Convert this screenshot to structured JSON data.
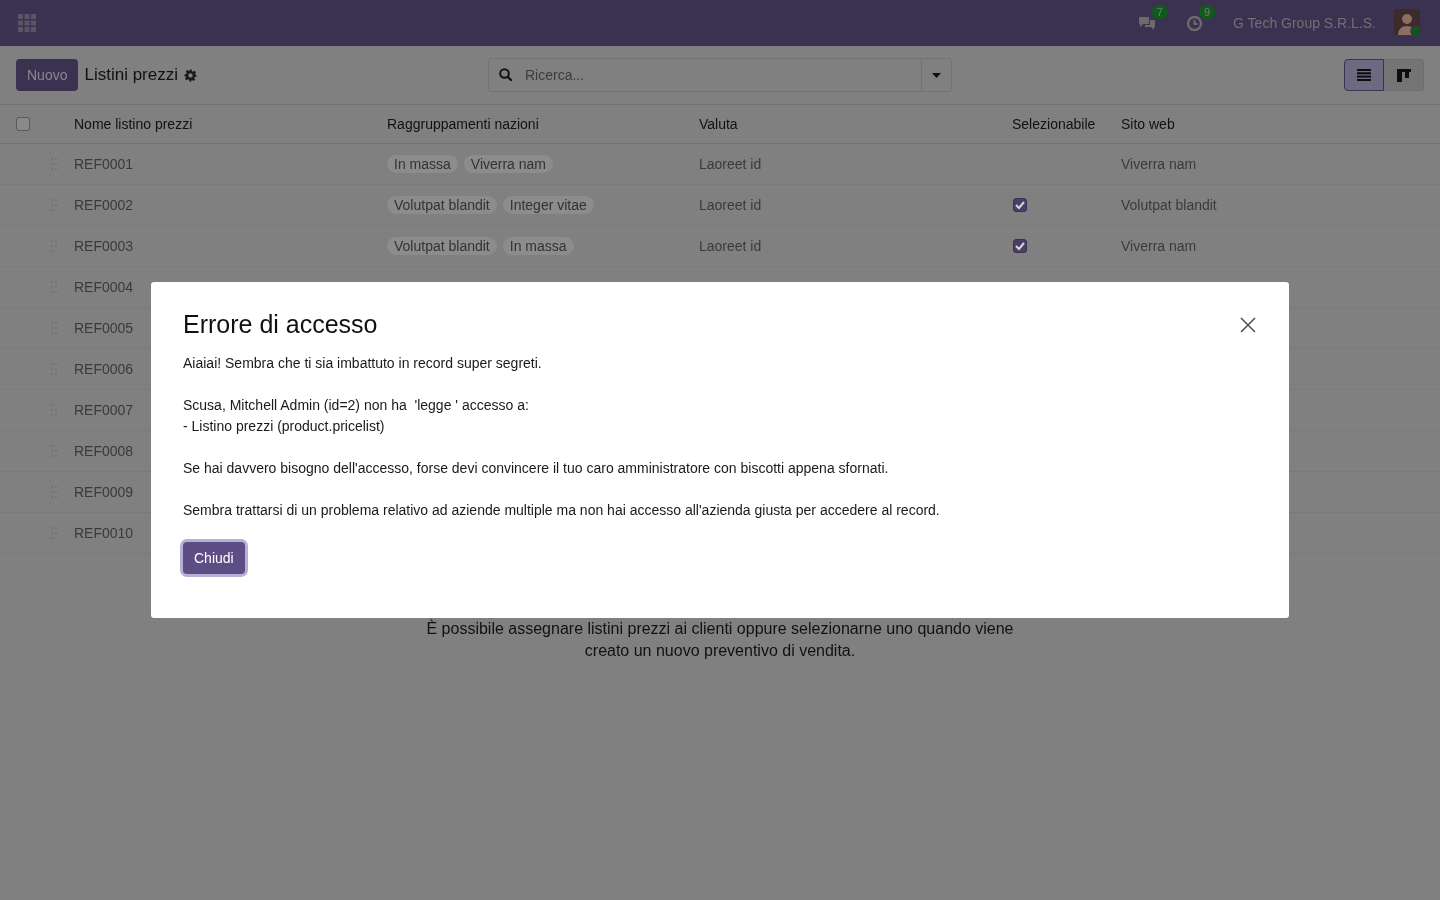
{
  "navbar": {
    "messages_badge": "7",
    "activities_badge": "9",
    "company": "G Tech Group S.R.L.S."
  },
  "control_panel": {
    "new_button": "Nuovo",
    "title": "Listini prezzi",
    "search": {
      "placeholder": "Ricerca..."
    },
    "views": [
      {
        "kind": "list",
        "selected": true
      },
      {
        "kind": "kanban",
        "selected": false
      }
    ]
  },
  "table": {
    "all_selected": false,
    "columns": [
      "Nome listino prezzi",
      "Raggruppamenti nazioni",
      "Valuta",
      "Selezionabile",
      "Sito web"
    ],
    "rows": [
      {
        "name": "REF0001",
        "groups": [
          "In massa",
          "Viverra nam"
        ],
        "currency": "Laoreet id",
        "selectable": false,
        "website": "Viverra nam"
      },
      {
        "name": "REF0002",
        "groups": [
          "Volutpat blandit",
          "Integer vitae"
        ],
        "currency": "Laoreet id",
        "selectable": true,
        "website": "Volutpat blandit"
      },
      {
        "name": "REF0003",
        "groups": [
          "Volutpat blandit",
          "In massa"
        ],
        "currency": "Laoreet id",
        "selectable": true,
        "website": "Viverra nam"
      },
      {
        "name": "REF0004"
      },
      {
        "name": "REF0005"
      },
      {
        "name": "REF0006"
      },
      {
        "name": "REF0007"
      },
      {
        "name": "REF0008"
      },
      {
        "name": "REF0009"
      },
      {
        "name": "REF0010"
      }
    ]
  },
  "help_text": [
    "È possibile assegnare listini prezzi ai clienti oppure selezionarne uno quando viene",
    "creato un nuovo preventivo di vendita."
  ],
  "dialog": {
    "title": "Errore di accesso",
    "paragraphs": [
      "Aiaiai! Sembra che ti sia imbattuto in record super segreti.",
      "Scusa, Mitchell Admin (id=2) non ha  'legge ' accesso a:\n- Listino prezzi (product.pricelist)",
      "Se hai davvero bisogno dell'accesso, forse devi convincere il tuo caro amministratore con biscotti appena sfornati.",
      "Sembra trattarsi di un problema relativo ad aziende multiple ma non hai accesso all'azienda giusta per accedere al record."
    ],
    "close_button": "Chiudi"
  }
}
